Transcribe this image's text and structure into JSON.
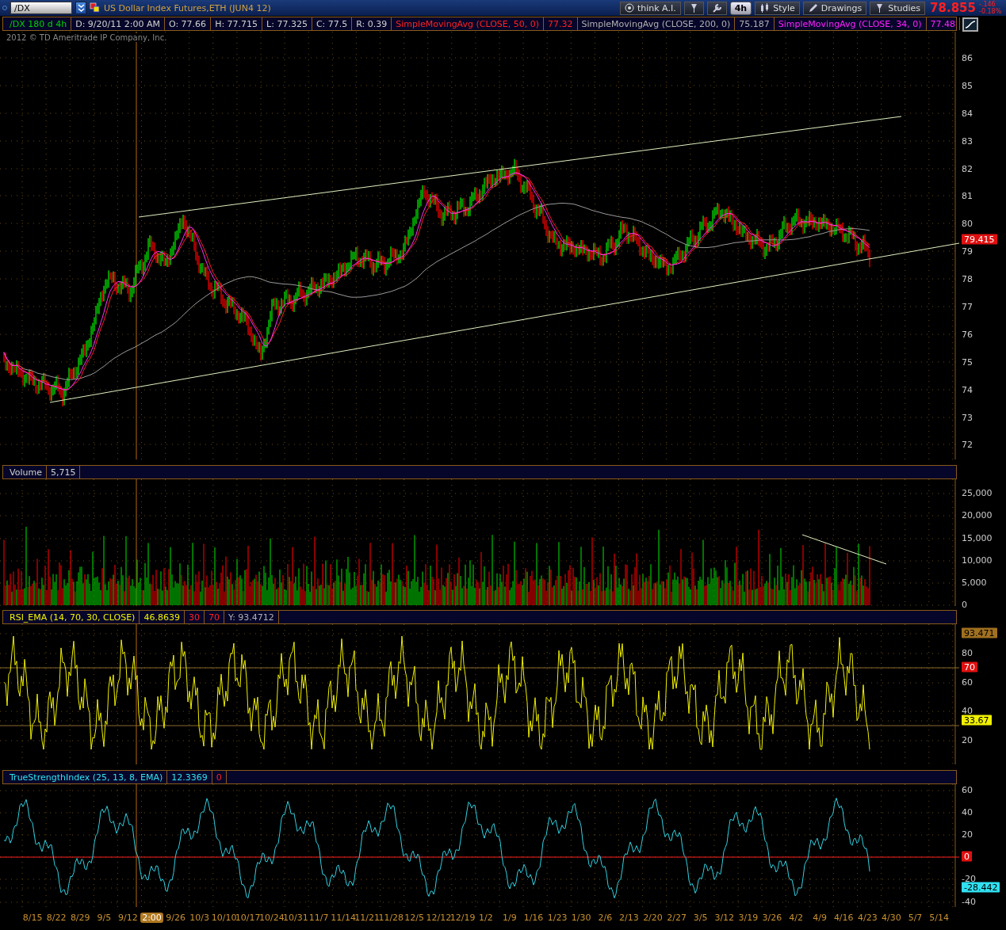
{
  "toolbar": {
    "symbol": "/DX",
    "instrument_title": "US Dollar Index Futures,ETH (JUN4 12)",
    "think_ai": "think A.I.",
    "aggregation": "4h",
    "style": "Style",
    "drawings": "Drawings",
    "studies": "Studies",
    "last_price": "78.855",
    "change": "-.146",
    "change_pct": "-0.18%"
  },
  "price_header": [
    {
      "text": "/DX 180 d 4h",
      "kind": "symbol"
    },
    {
      "text": "D: 9/20/11 2:00 AM",
      "kind": "readout"
    },
    {
      "text": "O: 77.66",
      "kind": "readout"
    },
    {
      "text": "H: 77.715",
      "kind": "readout"
    },
    {
      "text": "L: 77.325",
      "kind": "readout"
    },
    {
      "text": "C: 77.5",
      "kind": "readout"
    },
    {
      "text": "R: 0.39",
      "kind": "readout"
    },
    {
      "text": "SimpleMovingAvg (CLOSE, 50, 0)",
      "kind": "ma50"
    },
    {
      "text": "77.32",
      "kind": "ma50"
    },
    {
      "text": "SimpleMovingAvg (CLOSE, 200, 0)",
      "kind": "ma200"
    },
    {
      "text": "75.187",
      "kind": "ma200"
    },
    {
      "text": "SimpleMovingAvg (CLOSE, 34, 0)",
      "kind": "ma34"
    },
    {
      "text": "77.48",
      "kind": "ma34"
    }
  ],
  "copyright": "2012 © TD Ameritrade IP Company, Inc.",
  "price_axis": [
    {
      "text": "86",
      "kind": "tick"
    },
    {
      "text": "85",
      "kind": "tick"
    },
    {
      "text": "84",
      "kind": "tick"
    },
    {
      "text": "83",
      "kind": "tick"
    },
    {
      "text": "82",
      "kind": "tick"
    },
    {
      "text": "81",
      "kind": "tick"
    },
    {
      "text": "80",
      "kind": "tick"
    },
    {
      "text": "79.415",
      "kind": "alert"
    },
    {
      "text": "79",
      "kind": "tick"
    },
    {
      "text": "78",
      "kind": "tick"
    },
    {
      "text": "77",
      "kind": "tick"
    },
    {
      "text": "76",
      "kind": "tick"
    },
    {
      "text": "75",
      "kind": "tick"
    },
    {
      "text": "74",
      "kind": "tick"
    },
    {
      "text": "73",
      "kind": "tick"
    },
    {
      "text": "72",
      "kind": "tick"
    }
  ],
  "volume_header": [
    {
      "text": "Volume"
    },
    {
      "text": "5,715"
    }
  ],
  "volume_axis": [
    {
      "text": "25,000",
      "kind": "tick"
    },
    {
      "text": "20,000",
      "kind": "tick"
    },
    {
      "text": "15,000",
      "kind": "tick"
    },
    {
      "text": "10,000",
      "kind": "tick"
    },
    {
      "text": "5,000",
      "kind": "tick"
    },
    {
      "text": "0",
      "kind": "tick"
    }
  ],
  "rsi_header": [
    {
      "text": "RSI_EMA (14, 70, 30, CLOSE)",
      "kind": "rsi"
    },
    {
      "text": "46.8639",
      "kind": "rsi"
    },
    {
      "text": "30",
      "kind": "level"
    },
    {
      "text": "70",
      "kind": "level"
    },
    {
      "text": "Y: 93.4712",
      "kind": "ma200"
    }
  ],
  "rsi_axis": [
    {
      "text": "93.471",
      "kind": "cursor"
    },
    {
      "text": "80",
      "kind": "tick"
    },
    {
      "text": "70",
      "kind": "alert"
    },
    {
      "text": "60",
      "kind": "tick"
    },
    {
      "text": "40",
      "kind": "tick"
    },
    {
      "text": "33.67",
      "kind": "rsi"
    },
    {
      "text": "20",
      "kind": "tick"
    }
  ],
  "tsi_header": [
    {
      "text": "TrueStrengthIndex (25, 13, 8, EMA)",
      "kind": "tsi"
    },
    {
      "text": "12.3369",
      "kind": "tsi"
    },
    {
      "text": "0",
      "kind": "level"
    }
  ],
  "tsi_axis": [
    {
      "text": "60",
      "kind": "tick"
    },
    {
      "text": "40",
      "kind": "tick"
    },
    {
      "text": "20",
      "kind": "tick"
    },
    {
      "text": "0",
      "kind": "alert"
    },
    {
      "text": "-20",
      "kind": "tick"
    },
    {
      "text": "-28.442",
      "kind": "tsi"
    },
    {
      "text": "-40",
      "kind": "tick"
    }
  ],
  "date_axis": [
    {
      "text": "8/15",
      "selected": false
    },
    {
      "text": "8/22",
      "selected": false
    },
    {
      "text": "8/29",
      "selected": false
    },
    {
      "text": "9/5",
      "selected": false
    },
    {
      "text": "9/12",
      "selected": false
    },
    {
      "text": "2:00",
      "selected": true
    },
    {
      "text": "9/26",
      "selected": false
    },
    {
      "text": "10/3",
      "selected": false
    },
    {
      "text": "10/10",
      "selected": false
    },
    {
      "text": "10/17",
      "selected": false
    },
    {
      "text": "10/24",
      "selected": false
    },
    {
      "text": "10/31",
      "selected": false
    },
    {
      "text": "11/7",
      "selected": false
    },
    {
      "text": "11/14",
      "selected": false
    },
    {
      "text": "11/21",
      "selected": false
    },
    {
      "text": "11/28",
      "selected": false
    },
    {
      "text": "12/5",
      "selected": false
    },
    {
      "text": "12/12",
      "selected": false
    },
    {
      "text": "12/19",
      "selected": false
    },
    {
      "text": "1/2",
      "selected": false
    },
    {
      "text": "1/9",
      "selected": false
    },
    {
      "text": "1/16",
      "selected": false
    },
    {
      "text": "1/23",
      "selected": false
    },
    {
      "text": "1/30",
      "selected": false
    },
    {
      "text": "2/6",
      "selected": false
    },
    {
      "text": "2/13",
      "selected": false
    },
    {
      "text": "2/20",
      "selected": false
    },
    {
      "text": "2/27",
      "selected": false
    },
    {
      "text": "3/5",
      "selected": false
    },
    {
      "text": "3/12",
      "selected": false
    },
    {
      "text": "3/19",
      "selected": false
    },
    {
      "text": "3/26",
      "selected": false
    },
    {
      "text": "4/2",
      "selected": false
    },
    {
      "text": "4/9",
      "selected": false
    },
    {
      "text": "4/16",
      "selected": false
    },
    {
      "text": "4/23",
      "selected": false
    },
    {
      "text": "4/30",
      "selected": false
    },
    {
      "text": "5/7",
      "selected": false
    },
    {
      "text": "5/14",
      "selected": false
    }
  ]
}
